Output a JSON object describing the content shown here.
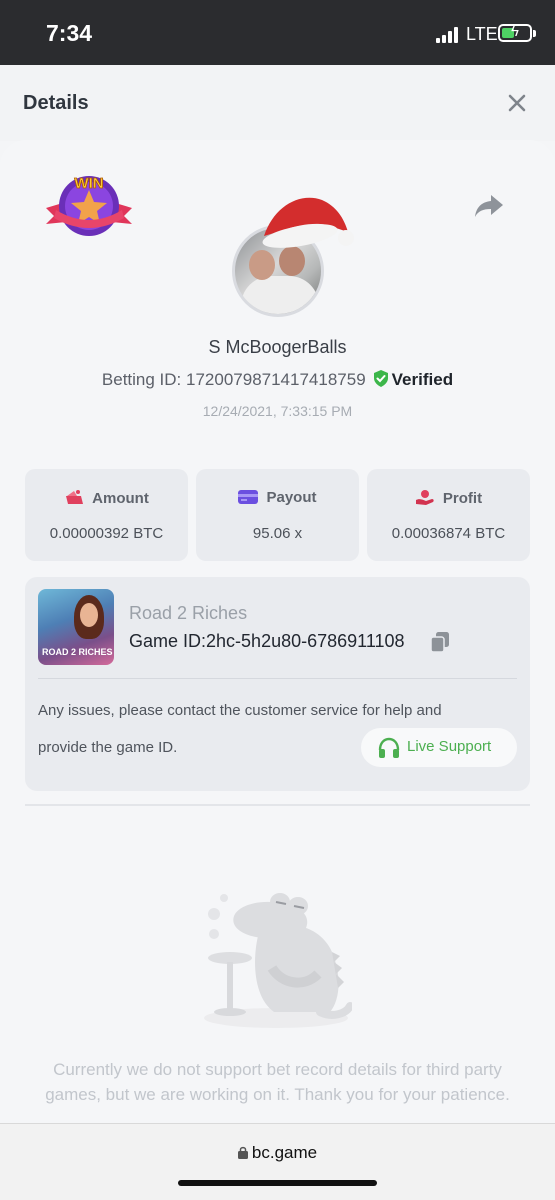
{
  "status_bar": {
    "time": "7:34",
    "network": "LTE"
  },
  "header": {
    "title": "Details"
  },
  "profile": {
    "badge_text": "WIN",
    "username": "S McBoogerBalls",
    "betting_id_label": "Betting ID:",
    "betting_id": "1720079871417418759",
    "verified_label": "Verified",
    "timestamp": "12/24/2021, 7:33:15 PM"
  },
  "stats": [
    {
      "label": "Amount",
      "value": "0.00000392 BTC",
      "icon": "amount-icon"
    },
    {
      "label": "Payout",
      "value": "95.06 x",
      "icon": "payout-icon"
    },
    {
      "label": "Profit",
      "value": "0.00036874 BTC",
      "icon": "profit-icon"
    }
  ],
  "game": {
    "name": "Road 2 Riches",
    "id_label": "Game ID:",
    "id": "2hc-5h2u80-6786911108",
    "thumb_label": "ROAD 2 RICHES",
    "issues_line1": "Any issues, please contact the customer service for help and",
    "issues_line2": "provide the game ID.",
    "support_label": "Live Support"
  },
  "notice": "Currently we do not support bet record details for third party games, but we are working on it. Thank you for your patience.",
  "browser": {
    "url": "bc.game"
  },
  "colors": {
    "verified": "#3cb64a",
    "support": "#4caf50",
    "payout": "#6b4fe0",
    "amount": "#e0405e"
  }
}
